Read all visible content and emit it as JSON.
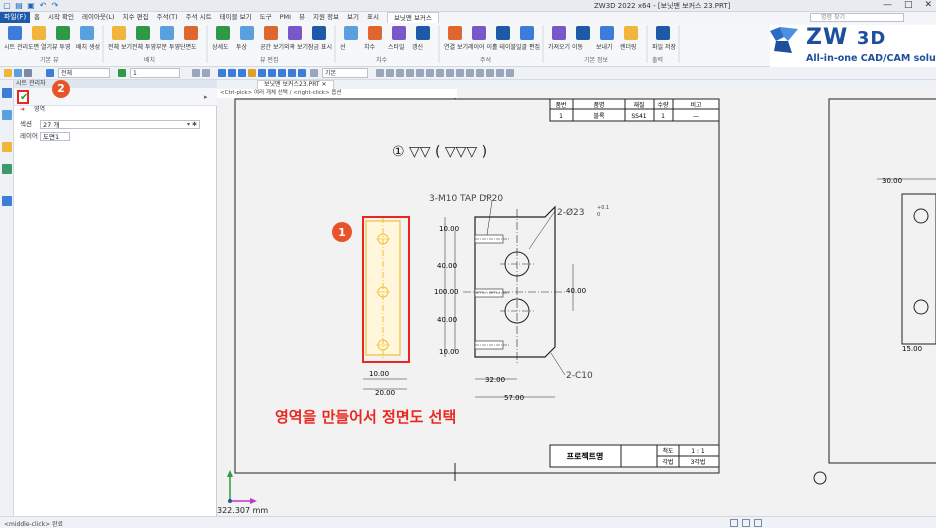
{
  "titlebar": {
    "title": "ZW3D 2022 x64 - [보닛맨 보커스 23.PRT]",
    "quick_access_icons": [
      "new-icon",
      "open-icon",
      "save-icon",
      "undo-icon",
      "redo-icon"
    ],
    "window_buttons": [
      "—",
      "□",
      "✕"
    ]
  },
  "menubar": {
    "active": "파일(F)",
    "items": [
      "홈",
      "시작 확인",
      "레이아웃(L)",
      "치수 편집",
      "주석(T)",
      "주석 시트",
      "테이블 보기",
      "도구",
      "PMI",
      "뷰",
      "지원 정보",
      "보기",
      "표시",
      "보닛맨 보커스"
    ],
    "highlighted_index": 13,
    "search_placeholder": "명령 찾기"
  },
  "ribbon": {
    "groups": [
      {
        "name": "기본 뷰",
        "tools": [
          "시트 관리",
          "도면 열기",
          "뷰 투영",
          "배치 생성"
        ]
      },
      {
        "name": "배치",
        "tools": [
          "전체 보기",
          "전체 투영",
          "부분 투영",
          "단면도"
        ]
      },
      {
        "name": "뷰 편집",
        "tools": [
          "상세도",
          "투상",
          "공간 보기",
          "외곽 보기",
          "잠금 표시"
        ]
      },
      {
        "name": "치수",
        "tools": [
          "선",
          "치수",
          "스타일",
          "갱신"
        ]
      },
      {
        "name": "주석",
        "tools": [
          "연결 보기",
          "레이어 이동",
          "홀 테이블",
          "일괄 편집"
        ]
      },
      {
        "name": "기본 정보",
        "tools": [
          "가져오기",
          "이동",
          "보내기",
          "렌더링"
        ]
      },
      {
        "name": "출력",
        "tools": [
          "파일 저장"
        ]
      }
    ],
    "logo": {
      "name_main": "ZW",
      "name_bold": "3D",
      "tagline": "All-in-one CAD/CAM solution"
    }
  },
  "cmdbar": {
    "filter_value": "전체",
    "layer_value": "1",
    "style_value": "기본"
  },
  "panel": {
    "header": "시트 관리자",
    "subhead": "영역",
    "fields": [
      {
        "label": "섹션",
        "value": "27 개"
      },
      {
        "label": "레이어",
        "value": "도면1"
      }
    ],
    "badge_2": "2"
  },
  "doctabs": {
    "active": "보닛맨 보커스23.PRT"
  },
  "hint": "<Ctrl-pick> 여러 개체 선택 / <right-click> 옵션",
  "canvas": {
    "title_block_header": [
      "품번",
      "품명",
      "재질",
      "수량",
      "비고"
    ],
    "title_block_row": [
      "1",
      "블록",
      "SS41",
      "1",
      "—"
    ],
    "finish_symbol": "① ▽▽ ( ▽▽▽ )",
    "tap_note": "3-M10 TAP DP20",
    "hole_note": "2-Ø23",
    "hole_tol_top": "+0.1",
    "hole_tol_bot": "0",
    "chamfer_note": "2-C10",
    "dims": {
      "d1000": "10.00",
      "d40a": "40.00",
      "d40b": "40.00",
      "d100": "100.00",
      "d10b": "10.00",
      "d1000b": "10.00",
      "d2000": "20.00",
      "d3200": "32.00",
      "d5700": "57.00",
      "d4000r": "40.00",
      "right30": "30.00",
      "right15": "15.00"
    },
    "badge_1": "1",
    "instruction": "영역을 만들어서 정면도 선택",
    "project_label": "프로젝트명",
    "scale_label": "척도",
    "scale_value": "1 : 1",
    "method_label": "각법",
    "method_value": "3각법",
    "coord_value": "322.307 mm",
    "colors": {
      "red": "#e8281f",
      "yellow": "#f1c232",
      "accent_blue": "#1e5aa8"
    }
  },
  "statusbar": {
    "text": "<middle-click> 완료"
  }
}
